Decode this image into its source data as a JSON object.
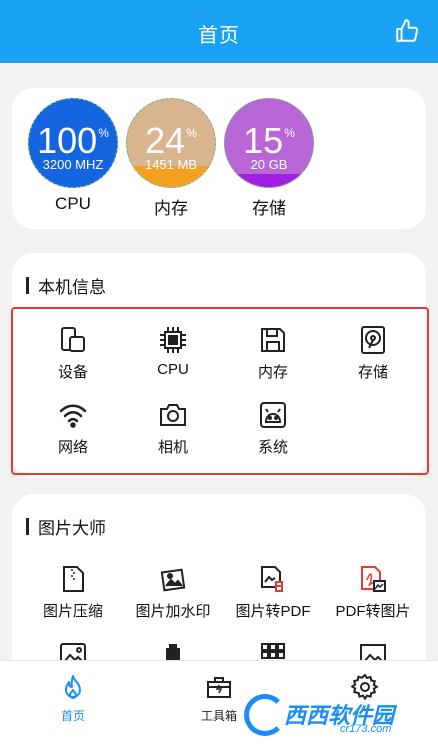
{
  "header": {
    "title": "首页"
  },
  "gauges": [
    {
      "percent": "100",
      "unit": "%",
      "sub": "3200 MHZ",
      "label": "CPU",
      "fill_fraction": 1.0,
      "color": "#1565e0"
    },
    {
      "percent": "24",
      "unit": "%",
      "sub": "1451 MB",
      "label": "内存",
      "fill_fraction": 0.24,
      "color": "#f5a020",
      "bg": "#d8b48f"
    },
    {
      "percent": "15",
      "unit": "%",
      "sub": "20 GB",
      "label": "存储",
      "fill_fraction": 0.15,
      "color": "#a020e0",
      "bg": "#b866d6"
    }
  ],
  "device_info": {
    "title": "本机信息",
    "items": [
      {
        "label": "设备",
        "icon": "device-icon"
      },
      {
        "label": "CPU",
        "icon": "cpu-icon"
      },
      {
        "label": "内存",
        "icon": "memory-icon"
      },
      {
        "label": "存储",
        "icon": "storage-icon"
      },
      {
        "label": "网络",
        "icon": "wifi-icon"
      },
      {
        "label": "相机",
        "icon": "camera-icon"
      },
      {
        "label": "系统",
        "icon": "android-icon"
      }
    ]
  },
  "image_master": {
    "title": "图片大师",
    "items": [
      {
        "label": "图片压缩",
        "icon": "zip-file-icon"
      },
      {
        "label": "图片加水印",
        "icon": "watermark-image-icon"
      },
      {
        "label": "图片转PDF",
        "icon": "image-to-pdf-icon"
      },
      {
        "label": "PDF转图片",
        "icon": "pdf-to-image-icon"
      }
    ]
  },
  "tabbar": {
    "tabs": [
      {
        "label": "首页",
        "icon": "flame-icon",
        "active": true
      },
      {
        "label": "工具箱",
        "icon": "toolbox-icon",
        "active": false
      },
      {
        "label": "",
        "icon": "gear-icon",
        "active": false
      }
    ]
  },
  "watermark": {
    "text": "西西软件园",
    "url": "cr173.com"
  },
  "colors": {
    "accent": "#1aa2f5",
    "highlight_border": "#e53935"
  }
}
